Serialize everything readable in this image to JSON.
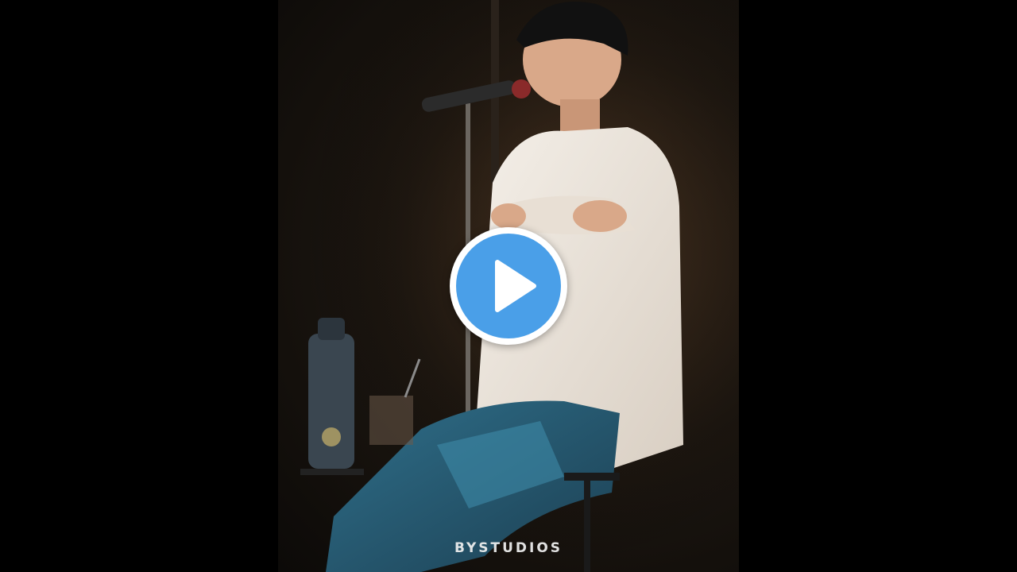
{
  "video": {
    "watermark_text": "BYSTUDIOS",
    "scene": "video-thumbnail"
  },
  "controls": {
    "play_icon": "play-icon"
  },
  "colors": {
    "letterbox": "#000000",
    "play_accent": "#4a9fe8",
    "play_ring": "#ffffff"
  }
}
